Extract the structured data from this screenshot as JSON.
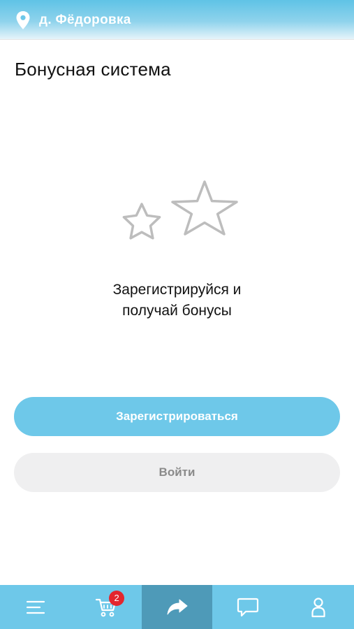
{
  "header": {
    "location": "д. Фёдоровка",
    "location_icon": "map-pin-icon"
  },
  "page": {
    "title": "Бонусная система"
  },
  "illustration": {
    "icon": "stars-icon"
  },
  "promo": {
    "line1": "Зарегистрируйся и",
    "line2": "получай бонусы"
  },
  "buttons": {
    "register": "Зарегистрироваться",
    "login": "Войти"
  },
  "bottom_nav": {
    "items": [
      {
        "icon": "menu-icon"
      },
      {
        "icon": "cart-icon",
        "badge": "2"
      },
      {
        "icon": "share-arrow-icon",
        "active": true
      },
      {
        "icon": "chat-icon"
      },
      {
        "icon": "user-icon"
      }
    ]
  },
  "colors": {
    "accent": "#6ec8e9",
    "nav_active": "#4e9ab8",
    "badge": "#e3262e",
    "secondary_button": "#efeff0"
  }
}
